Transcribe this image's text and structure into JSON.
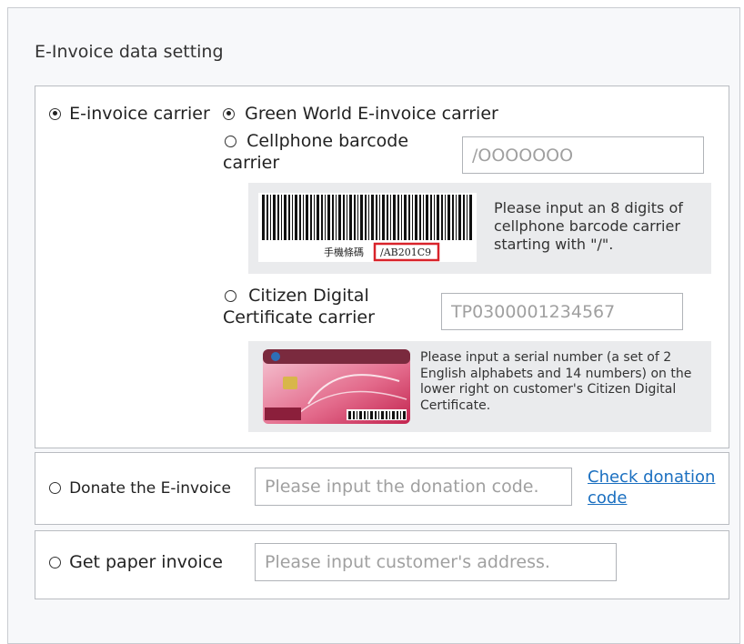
{
  "section_title": "E-Invoice data setting",
  "carrier": {
    "label": "E-invoice carrier",
    "green_world": {
      "label": "Green World E-invoice carrier"
    },
    "cellphone": {
      "label_line1": "Cellphone barcode",
      "label_line2": "carrier",
      "input_placeholder": "/OOOOOOO",
      "hint": "Please input an 8 digits of cellphone barcode carrier starting with \"/\".",
      "barcode_caption": "手機條碼",
      "barcode_code": "/AB201C9",
      "highlight_color": "#d8232a"
    },
    "citizen": {
      "label_line1": "Citizen Digital",
      "label_line2": "Certificate carrier",
      "input_placeholder": "TP0300001234567",
      "hint": "Please input a serial number (a set of 2 English alphabets and 14 numbers) on the lower right on customer's Citizen Digital Certificate."
    }
  },
  "donate": {
    "label": "Donate the E-invoice",
    "input_placeholder": "Please input the donation code.",
    "link": "Check donation code"
  },
  "paper": {
    "label": "Get paper invoice",
    "input_placeholder": "Please input customer's address."
  },
  "colors": {
    "link": "#1a6fc0",
    "panel_bg": "#f7f8fa",
    "border": "#b9bcc1"
  }
}
